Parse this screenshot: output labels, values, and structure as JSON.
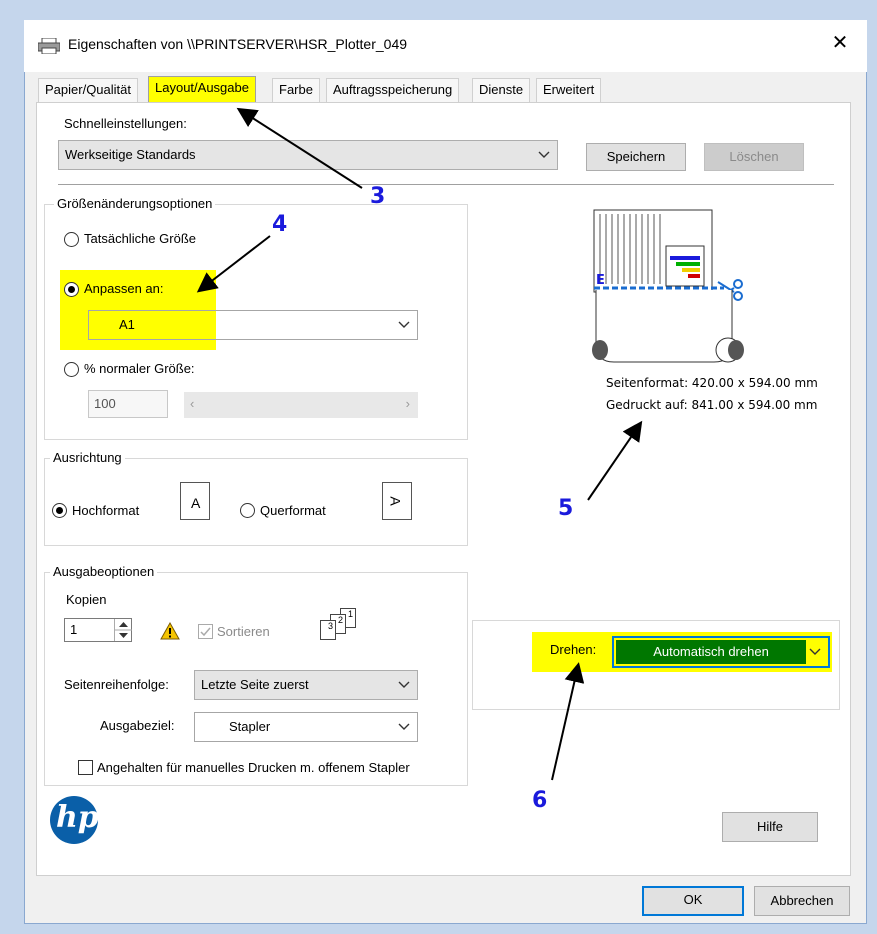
{
  "window": {
    "title": "Eigenschaften von \\\\PRINTSERVER\\HSR_Plotter_049",
    "close_glyph": "✕"
  },
  "tabs": [
    {
      "label": "Papier/Qualität"
    },
    {
      "label": "Layout/Ausgabe",
      "active": true
    },
    {
      "label": "Farbe"
    },
    {
      "label": "Auftragsspeicherung"
    },
    {
      "label": "Dienste"
    },
    {
      "label": "Erweitert"
    }
  ],
  "quick": {
    "label": "Schnelleinstellungen:",
    "value": "Werkseitige Standards",
    "save_label": "Speichern",
    "delete_label": "Löschen"
  },
  "resize": {
    "title": "Größenänderungsoptionen",
    "actual_label": "Tatsächliche Größe",
    "fit_label": "Anpassen an:",
    "fit_value": "A1",
    "percent_label": "% normaler Größe:",
    "percent_value": "100",
    "scroll_left": "‹",
    "scroll_right": "›"
  },
  "orientation": {
    "title": "Ausrichtung",
    "portrait_label": "Hochformat",
    "landscape_label": "Querformat",
    "icon_letter": "A"
  },
  "output": {
    "title": "Ausgabeoptionen",
    "copies_label": "Kopien",
    "copies_value": "1",
    "collate_label": "Sortieren",
    "page_order_label": "Seitenreihenfolge:",
    "page_order_value": "Letzte Seite zuerst",
    "destination_label": "Ausgabeziel:",
    "destination_value": "Stapler",
    "hold_label": "Angehalten für manuelles Drucken m. offenem Stapler",
    "stack_numbers": [
      "3",
      "2",
      "1"
    ]
  },
  "preview": {
    "page_format": "Seitenformat: 420.00 x 594.00 mm",
    "printed_on": "Gedruckt auf: 841.00 x 594.00 mm",
    "marker_letter": "E"
  },
  "rotate": {
    "label": "Drehen:",
    "value": "Automatisch drehen"
  },
  "buttons": {
    "help": "Hilfe",
    "ok": "OK",
    "cancel": "Abbrechen"
  },
  "logo_text": "hp",
  "annotations": [
    "3",
    "4",
    "5",
    "6"
  ],
  "colors": {
    "highlight": "#ffff00",
    "rotate_bg": "#007700",
    "annotation": "#1a1adc",
    "focus_border": "#0078d7"
  }
}
